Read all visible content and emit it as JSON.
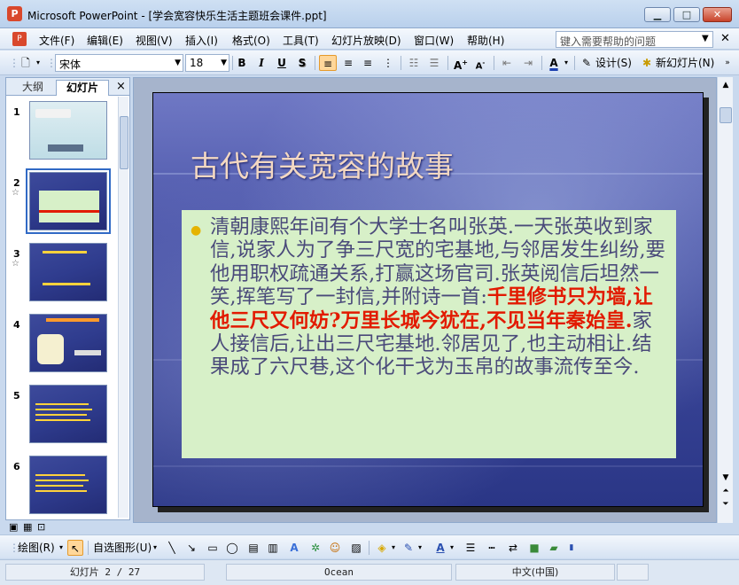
{
  "window": {
    "title": "Microsoft PowerPoint - [学会宽容快乐生活主题班会课件.ppt]",
    "minimize": "▁",
    "maximize": "□",
    "close": "✕"
  },
  "menu": {
    "items": [
      "文件(F)",
      "编辑(E)",
      "视图(V)",
      "插入(I)",
      "格式(O)",
      "工具(T)",
      "幻灯片放映(D)",
      "窗口(W)",
      "帮助(H)"
    ],
    "help_placeholder": "键入需要帮助的问题"
  },
  "toolbar": {
    "font_name": "宋体",
    "font_size": "18",
    "bold": "B",
    "italic": "I",
    "underline": "U",
    "shadow": "S",
    "design_label": "设计(S)",
    "new_slide_label": "新幻灯片(N)"
  },
  "left_pane": {
    "tab_outline": "大纲",
    "tab_slides": "幻灯片",
    "close": "×",
    "thumbnails": [
      {
        "number": "1",
        "star": ""
      },
      {
        "number": "2",
        "star": "☆"
      },
      {
        "number": "3",
        "star": "☆"
      },
      {
        "number": "4",
        "star": ""
      },
      {
        "number": "5",
        "star": ""
      },
      {
        "number": "6",
        "star": ""
      }
    ]
  },
  "slide": {
    "title": "古代有关宽容的故事",
    "body_part1": "清朝康熙年间有个大学士名叫张英.一天张英收到家信,说家人为了争三尺宽的宅基地,与邻居发生纠纷,要他用职权疏通关系,打赢这场官司.张英阅信后坦然一笑,挥笔写了一封信,并附诗一首:",
    "body_highlight": "千里修书只为墙,让他三尺又何妨?万里长城今犹在,不见当年秦始皇.",
    "body_part2": "家人接信后,让出三尺宅基地.邻居见了,也主动相让.结果成了六尺巷,这个化干戈为玉帛的故事流传至今."
  },
  "drawbar": {
    "draw_label": "绘图(R)",
    "autoshapes_label": "自选图形(U)"
  },
  "status": {
    "slide_indicator": "幻灯片 2 / 27",
    "theme": "Ocean",
    "language": "中文(中国)"
  }
}
